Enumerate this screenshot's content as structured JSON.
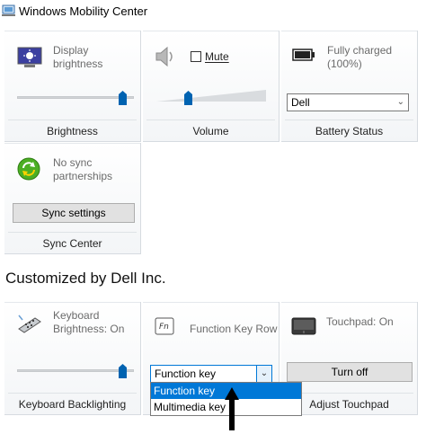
{
  "window": {
    "title": "Windows Mobility Center"
  },
  "tiles": {
    "brightness": {
      "status": "Display brightness",
      "label": "Brightness",
      "level": 0.93
    },
    "volume": {
      "mute_label": "Mute",
      "label": "Volume",
      "level": 0.27,
      "muted": false
    },
    "battery": {
      "status": "Fully charged (100%)",
      "plan": "Dell",
      "label": "Battery Status"
    },
    "sync": {
      "status": "No sync partnerships",
      "button": "Sync settings",
      "label": "Sync Center"
    }
  },
  "section": {
    "title": "Customized by Dell Inc."
  },
  "dell_tiles": {
    "keyboard": {
      "status": "Keyboard Brightness: On",
      "label": "Keyboard Backlighting",
      "level": 0.93
    },
    "fnrow": {
      "status": "Function Key Row",
      "value": "Function key",
      "options": [
        "Function key",
        "Multimedia key"
      ],
      "selected_index": 0
    },
    "touchpad": {
      "status": "Touchpad: On",
      "button": "Turn off",
      "label": "Adjust Touchpad"
    }
  },
  "colors": {
    "accent": "#0063b1",
    "selection": "#0078d7"
  }
}
